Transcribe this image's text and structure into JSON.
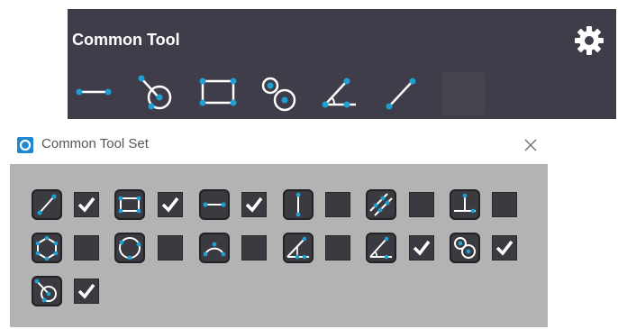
{
  "toolbar": {
    "title": "Common Tool",
    "settings_icon": "gear-icon",
    "tools": [
      {
        "name": "line-tool",
        "icon": "line-icon"
      },
      {
        "name": "circle-tangent-tool",
        "icon": "circle-tangent-icon"
      },
      {
        "name": "rectangle-tool",
        "icon": "rectangle-icon"
      },
      {
        "name": "two-circles-tool",
        "icon": "two-circles-icon"
      },
      {
        "name": "angle-tool",
        "icon": "angle-icon"
      },
      {
        "name": "diagonal-line-tool",
        "icon": "diagonal-line-icon"
      },
      {
        "name": "empty-slot",
        "icon": ""
      }
    ]
  },
  "dialog": {
    "title": "Common Tool Set",
    "close_icon": "close-icon",
    "tools": [
      {
        "icon": "diagonal-line-icon",
        "checked": true
      },
      {
        "icon": "rectangle-icon",
        "checked": true
      },
      {
        "icon": "line-icon",
        "checked": true
      },
      {
        "icon": "vertical-line-icon",
        "checked": false
      },
      {
        "icon": "parallel-lines-icon",
        "checked": false
      },
      {
        "icon": "perpendicular-icon",
        "checked": false
      },
      {
        "icon": "polygon-icon",
        "checked": false
      },
      {
        "icon": "circle-icon",
        "checked": false
      },
      {
        "icon": "arc-icon",
        "checked": false
      },
      {
        "icon": "triangle-angle-icon",
        "checked": false
      },
      {
        "icon": "angle-icon",
        "checked": true
      },
      {
        "icon": "two-circles-icon",
        "checked": true
      },
      {
        "icon": "circle-tangent-icon",
        "checked": true
      }
    ]
  },
  "colors": {
    "toolbar_bg": "#3f3d49",
    "accent": "#1ea0d2",
    "dialog_body": "#b3b3b3",
    "button_bg": "#3a3a40"
  }
}
